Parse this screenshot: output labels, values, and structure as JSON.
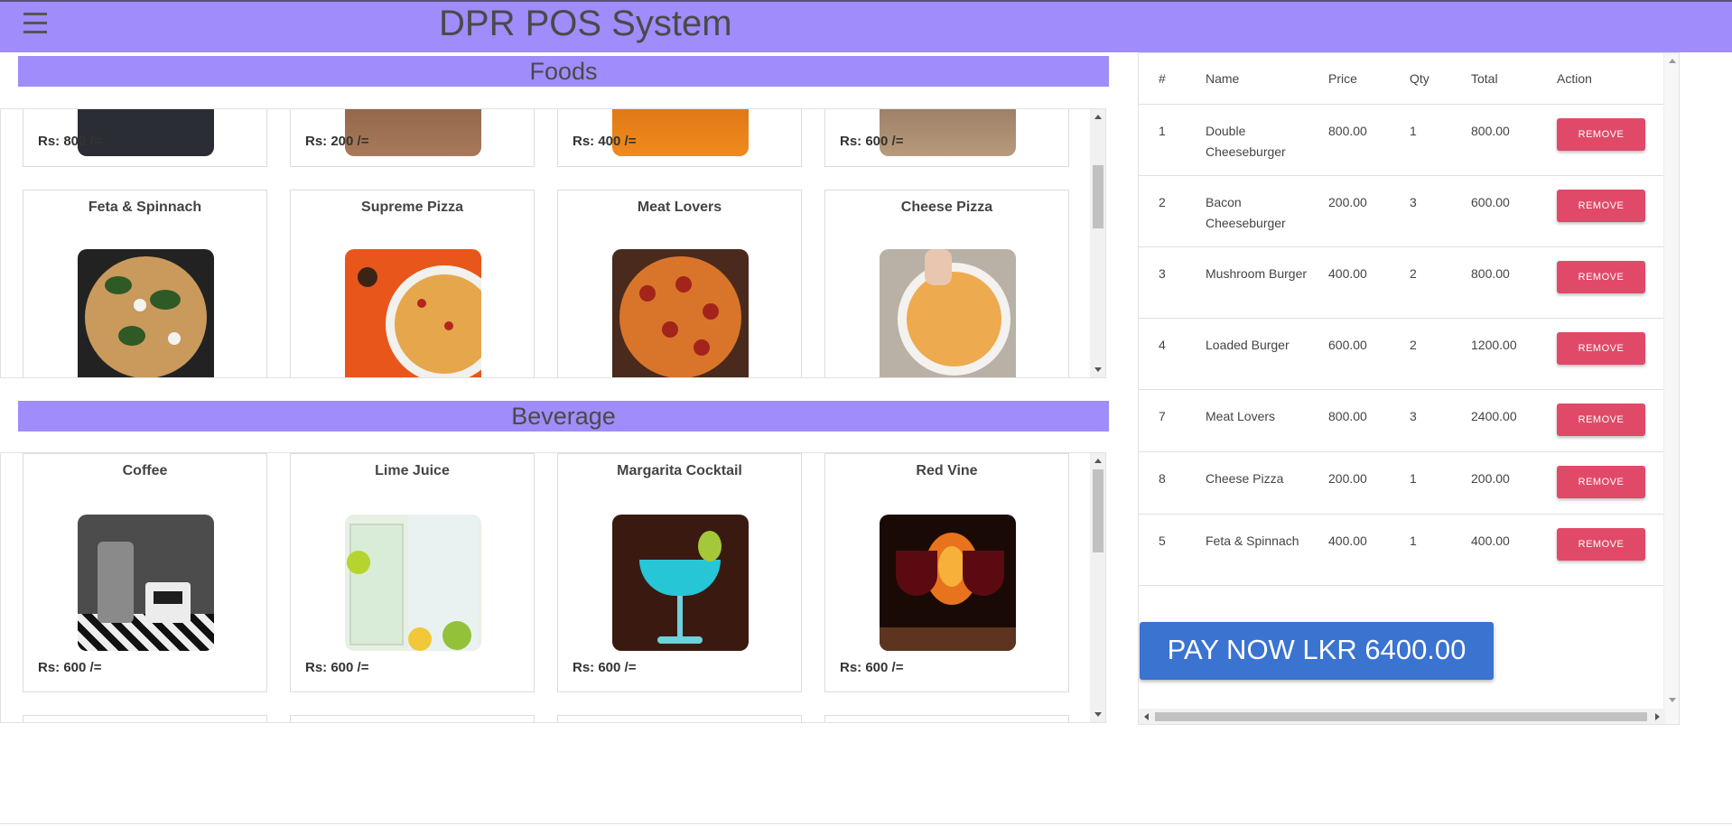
{
  "header": {
    "title": "DPR POS System",
    "menu_icon": "hamburger-menu-icon",
    "color": "#a08cfb"
  },
  "foods": {
    "title": "Foods",
    "partial_row_prices": [
      "Rs: 800 /=",
      "Rs: 200 /=",
      "Rs: 400 /=",
      "Rs: 600 /="
    ],
    "items": [
      {
        "name": "Feta & Spinnach"
      },
      {
        "name": "Supreme Pizza"
      },
      {
        "name": "Meat Lovers"
      },
      {
        "name": "Cheese Pizza"
      }
    ]
  },
  "beverage": {
    "title": "Beverage",
    "items": [
      {
        "name": "Coffee",
        "price": "Rs: 600 /="
      },
      {
        "name": "Lime Juice",
        "price": "Rs: 600 /="
      },
      {
        "name": "Margarita Cocktail",
        "price": "Rs: 600 /="
      },
      {
        "name": "Red Vine",
        "price": "Rs: 600 /="
      }
    ]
  },
  "order": {
    "columns": [
      "#",
      "Name",
      "Price",
      "Qty",
      "Total",
      "Action"
    ],
    "rows": [
      {
        "id": "1",
        "name": "Double Cheeseburger",
        "price": "800.00",
        "qty": "1",
        "total": "800.00",
        "action": "REMOVE"
      },
      {
        "id": "2",
        "name": "Bacon Cheeseburger",
        "price": "200.00",
        "qty": "3",
        "total": "600.00",
        "action": "REMOVE"
      },
      {
        "id": "3",
        "name": "Mushroom Burger",
        "price": "400.00",
        "qty": "2",
        "total": "800.00",
        "action": "REMOVE"
      },
      {
        "id": "4",
        "name": "Loaded Burger",
        "price": "600.00",
        "qty": "2",
        "total": "1200.00",
        "action": "REMOVE"
      },
      {
        "id": "7",
        "name": "Meat Lovers",
        "price": "800.00",
        "qty": "3",
        "total": "2400.00",
        "action": "REMOVE"
      },
      {
        "id": "8",
        "name": "Cheese Pizza",
        "price": "200.00",
        "qty": "1",
        "total": "200.00",
        "action": "REMOVE"
      },
      {
        "id": "5",
        "name": "Feta & Spinnach",
        "price": "400.00",
        "qty": "1",
        "total": "400.00",
        "action": "REMOVE"
      }
    ],
    "pay_button": "PAY NOW LKR 6400.00",
    "remove_color": "#e04a68",
    "pay_color": "#3a73d0"
  }
}
